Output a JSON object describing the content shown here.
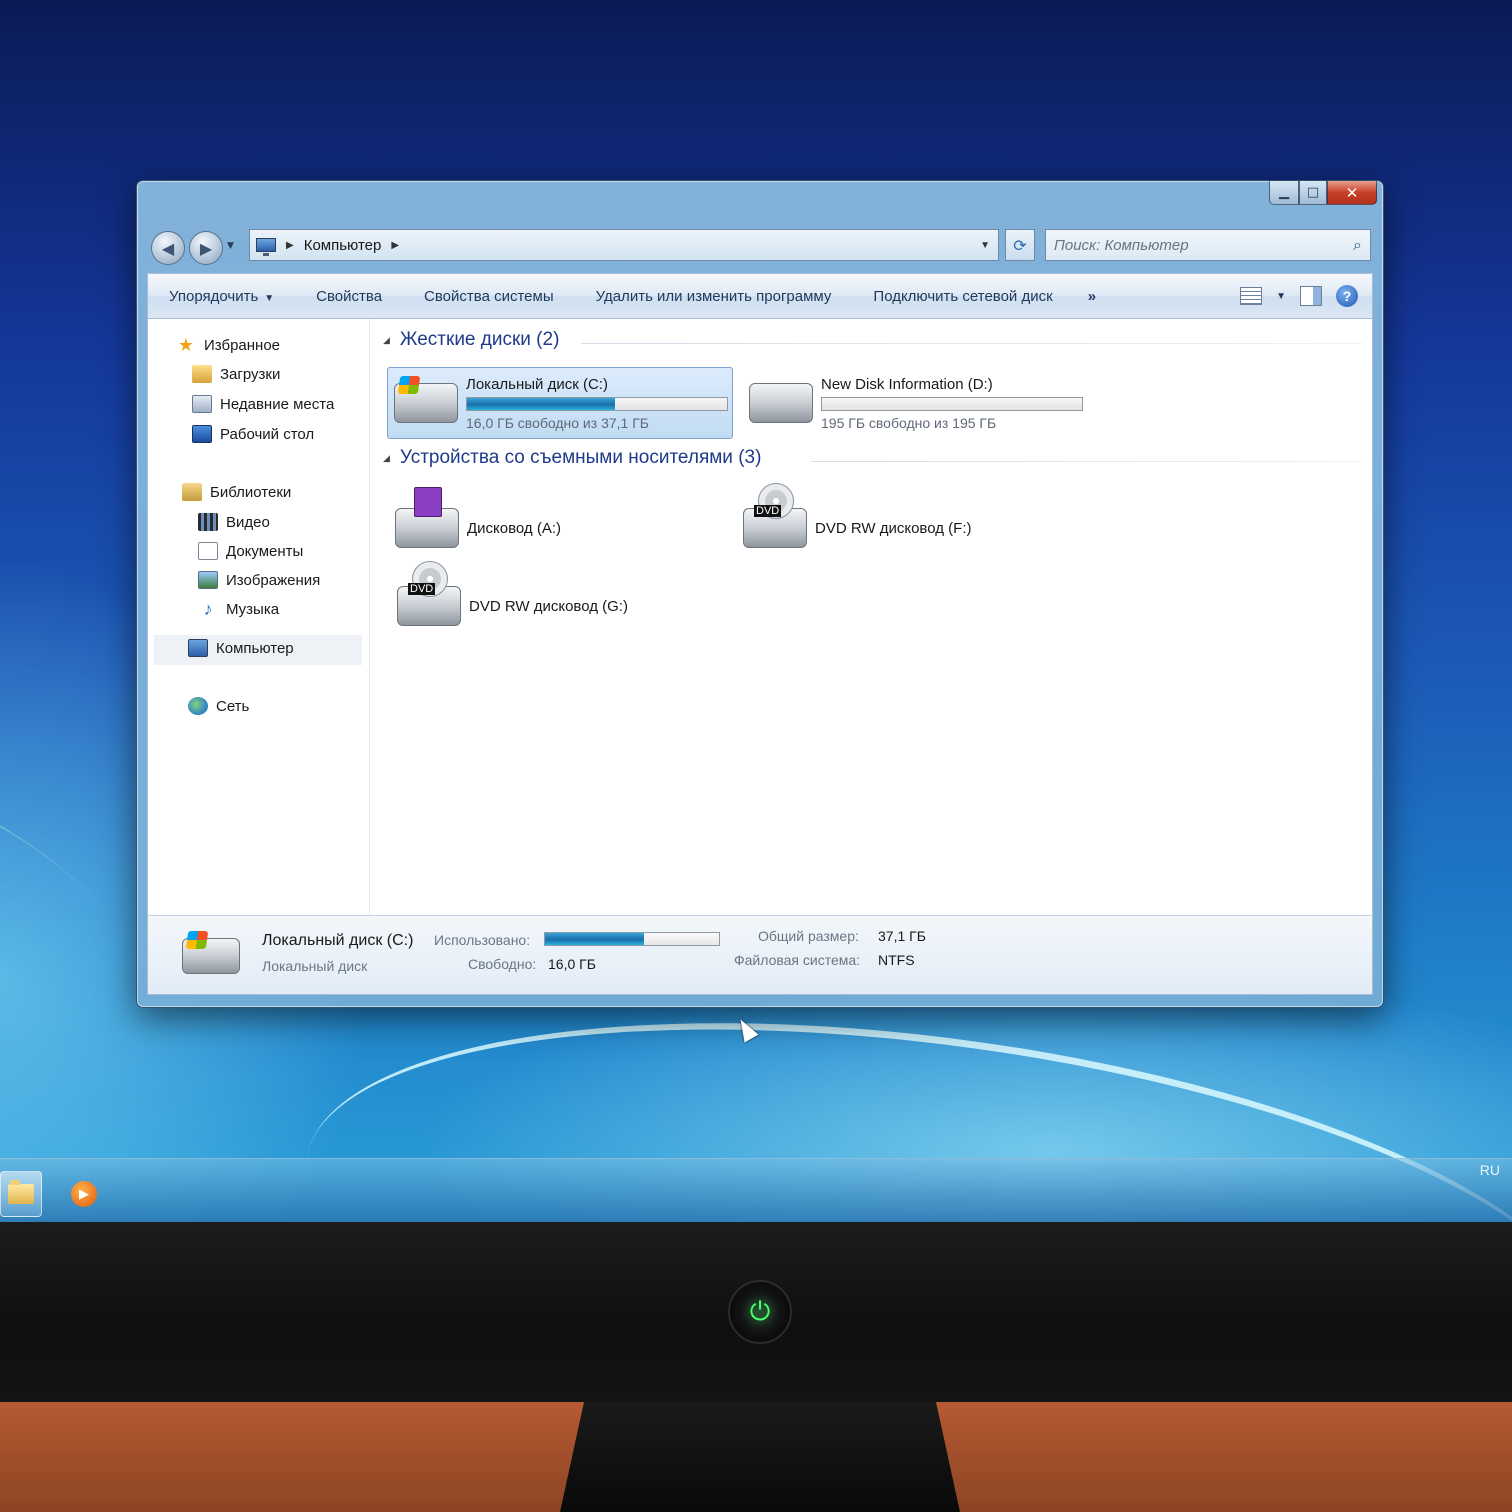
{
  "window": {
    "caption_buttons": {
      "minimize": "▁",
      "maximize": "□",
      "close": "✕"
    },
    "nav": {
      "back": "◀",
      "forward": "▶",
      "history": "▼",
      "breadcrumb": [
        "Компьютер"
      ],
      "breadcrumb_sep": "▶",
      "address_dropdown": "▼",
      "refresh": "⟳",
      "search_placeholder": "Поиск: Компьютер",
      "search_icon": "search-icon"
    },
    "commands": {
      "organize": "Упорядочить",
      "properties": "Свойства",
      "system_properties": "Свойства системы",
      "uninstall": "Удалить или изменить программу",
      "map_drive": "Подключить сетевой диск",
      "more": "»",
      "view_dropdown": "▼",
      "help": "?"
    },
    "nav_pane": {
      "favorites": "Избранное",
      "downloads": "Загрузки",
      "recent": "Недавние места",
      "desktop": "Рабочий стол",
      "libraries": "Библиотеки",
      "videos": "Видео",
      "documents": "Документы",
      "pictures": "Изображения",
      "music": "Музыка",
      "computer": "Компьютер",
      "network": "Сеть"
    },
    "groups": {
      "hard_drives": {
        "title": "Жесткие диски (2)",
        "toggle": "◢"
      },
      "removable": {
        "title": "Устройства со съемными носителями (3)",
        "toggle": "◢"
      }
    },
    "drives": [
      {
        "name": "Локальный диск (C:)",
        "meta": "16,0 ГБ свободно из 37,1 ГБ",
        "used_percent": 57,
        "selected": true
      },
      {
        "name": "New Disk Information (D:)",
        "meta": "195 ГБ свободно из 195 ГБ",
        "used_percent": 0,
        "selected": false
      }
    ],
    "removable": [
      {
        "name": "Дисковод (A:)",
        "icon": "floppy-drive-icon"
      },
      {
        "name": "DVD RW дисковод (F:)",
        "icon": "dvd-drive-icon"
      },
      {
        "name": "DVD RW дисковод (G:)",
        "icon": "dvd-drive-icon"
      }
    ],
    "details": {
      "name": "Локальный диск (C:)",
      "type": "Локальный диск",
      "used_label": "Использовано:",
      "free_label": "Свободно:",
      "free_value": "16,0 ГБ",
      "total_label": "Общий размер:",
      "total_value": "37,1 ГБ",
      "fs_label": "Файловая система:",
      "fs_value": "NTFS",
      "used_percent": 57
    }
  },
  "taskbar": {
    "language": "RU"
  },
  "monitor": {
    "power_glyph": "⏻"
  },
  "colors": {
    "accent": "#1e3a8a",
    "bar_fill": "#1a6ea8",
    "power_led": "#48ff6e"
  }
}
